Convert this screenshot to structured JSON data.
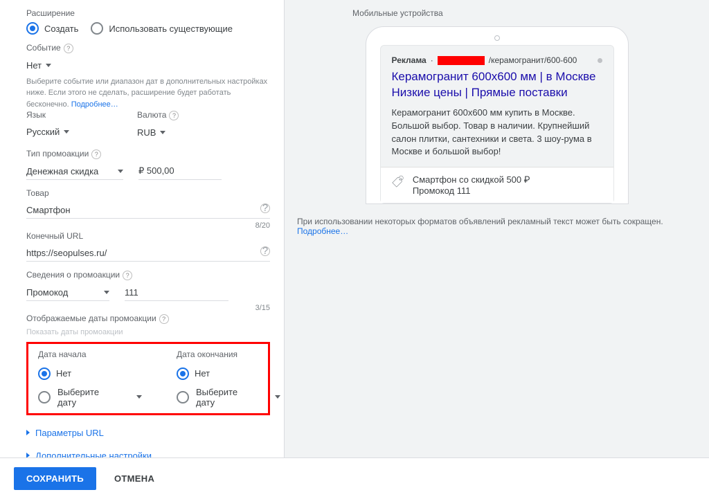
{
  "extension": {
    "label": "Расширение",
    "create": "Создать",
    "use_existing": "Использовать существующие"
  },
  "event": {
    "label": "Событие",
    "value": "Нет",
    "hint": "Выберите событие или диапазон дат в дополнительных настройках ниже. Если этого не сделать, расширение будет работать бесконечно.",
    "learn_more": "Подробнее…"
  },
  "language": {
    "label": "Язык",
    "value": "Русский"
  },
  "currency": {
    "label": "Валюта",
    "value": "RUB"
  },
  "promo_type": {
    "label": "Тип промоакции",
    "value": "Денежная скидка",
    "amount": "₽ 500,00"
  },
  "product": {
    "label": "Товар",
    "value": "Смартфон",
    "count": "8/20"
  },
  "final_url": {
    "label": "Конечный URL",
    "value": "https://seopulses.ru/"
  },
  "promo_info": {
    "label": "Сведения о промоакции",
    "select": "Промокод",
    "code": "111",
    "count": "3/15"
  },
  "display_dates": {
    "label": "Отображаемые даты промоакции",
    "sub": "Показать даты промоакции"
  },
  "dates": {
    "start_label": "Дата начала",
    "end_label": "Дата окончания",
    "none": "Нет",
    "pick": "Выберите дату"
  },
  "expanders": {
    "url_params": "Параметры URL",
    "advanced": "Дополнительные настройки"
  },
  "preview": {
    "device_label": "Мобильные устройства",
    "ad_label": "Реклама",
    "url_path": "/керамогранит/600-600",
    "title_line1": "Керамогранит 600х600 мм | в Москве",
    "title_line2": "Низкие цены | Прямые поставки",
    "description": "Керамогранит 600х600 мм купить в Москве. Большой выбор. Товар в наличии. Крупнейший салон плитки, сантехники и света. 3 шоу-рума в Москве и большой выбор!",
    "ext_line1": "Смартфон со скидкой 500 ₽",
    "ext_line2": "Промокод 111",
    "footnote": "При использовании некоторых форматов объявлений рекламный текст может быть сокращен.",
    "learn_more": "Подробнее…"
  },
  "buttons": {
    "save": "СОХРАНИТЬ",
    "cancel": "ОТМЕНА"
  }
}
